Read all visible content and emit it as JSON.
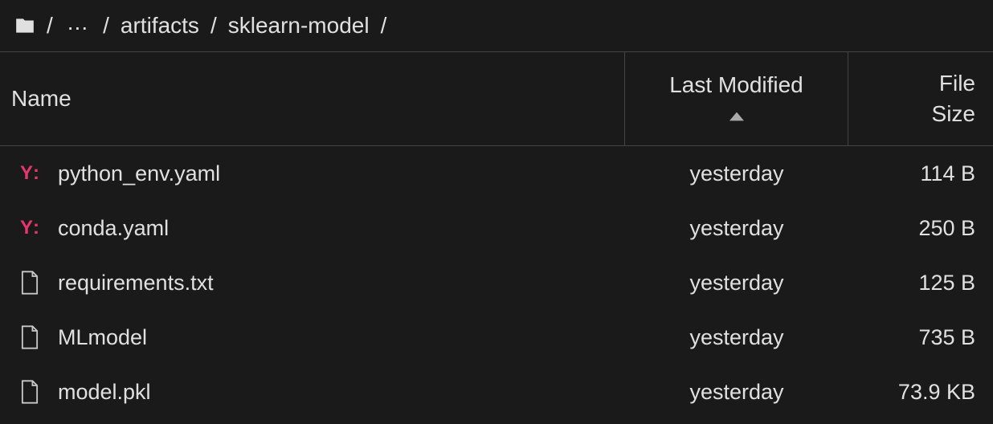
{
  "breadcrumb": {
    "ellipsis": "...",
    "segments": [
      "artifacts",
      "sklearn-model"
    ]
  },
  "columns": {
    "name": "Name",
    "last_modified": "Last Modified",
    "file_size_line1": "File",
    "file_size_line2": "Size"
  },
  "rows": [
    {
      "icon": "yaml",
      "name": "python_env.yaml",
      "modified": "yesterday",
      "size": "114 B"
    },
    {
      "icon": "yaml",
      "name": "conda.yaml",
      "modified": "yesterday",
      "size": "250 B"
    },
    {
      "icon": "file",
      "name": "requirements.txt",
      "modified": "yesterday",
      "size": "125 B"
    },
    {
      "icon": "file",
      "name": "MLmodel",
      "modified": "yesterday",
      "size": "735 B"
    },
    {
      "icon": "file",
      "name": "model.pkl",
      "modified": "yesterday",
      "size": "73.9 KB"
    }
  ]
}
